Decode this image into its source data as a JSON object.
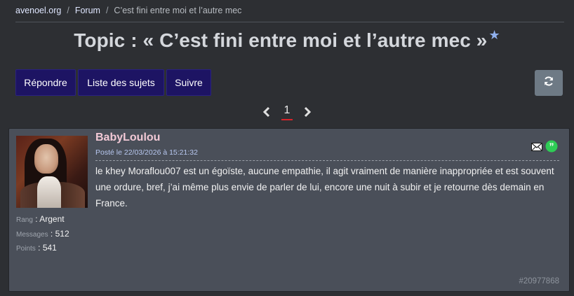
{
  "breadcrumb": {
    "site": "avenoel.org",
    "forum": "Forum",
    "current": "C’est fini entre moi et l’autre mec",
    "separator": "/"
  },
  "topic": {
    "title": "Topic : « C’est fini entre moi et l’autre mec »",
    "star": "★"
  },
  "toolbar": {
    "reply_label": "Répondre",
    "subjects_label": "Liste des sujets",
    "follow_label": "Suivre"
  },
  "pagination": {
    "current_page": "1"
  },
  "post": {
    "author": "BabyLoulou",
    "date": "Posté le 22/03/2026 à 15:21:32",
    "body": "le khey Moraflou007 est un égoïste, aucune empathie, il agit vraiment de manière inappropriée et est souvent une ordure, bref, j’ai même plus envie de parler de lui, encore une nuit à subir et je retourne dès demain en France.",
    "id": "#20977868",
    "stats": {
      "rank_label": "Rang",
      "rank_value": "Argent",
      "messages_label": "Messages",
      "messages_value": "512",
      "points_label": "Points",
      "points_value": "541",
      "sep": " : "
    }
  },
  "colors": {
    "background": "#2d2f33",
    "button": "#1d1463",
    "post_bg": "#4a4f59",
    "author": "#f2c9d6",
    "page_underline": "#d8232a",
    "quote_icon": "#2ecc55"
  },
  "icons": {
    "refresh": "refresh-icon",
    "prev": "chevron-left-icon",
    "next": "chevron-right-icon",
    "mail": "mail-icon",
    "quote": "quote-icon"
  }
}
